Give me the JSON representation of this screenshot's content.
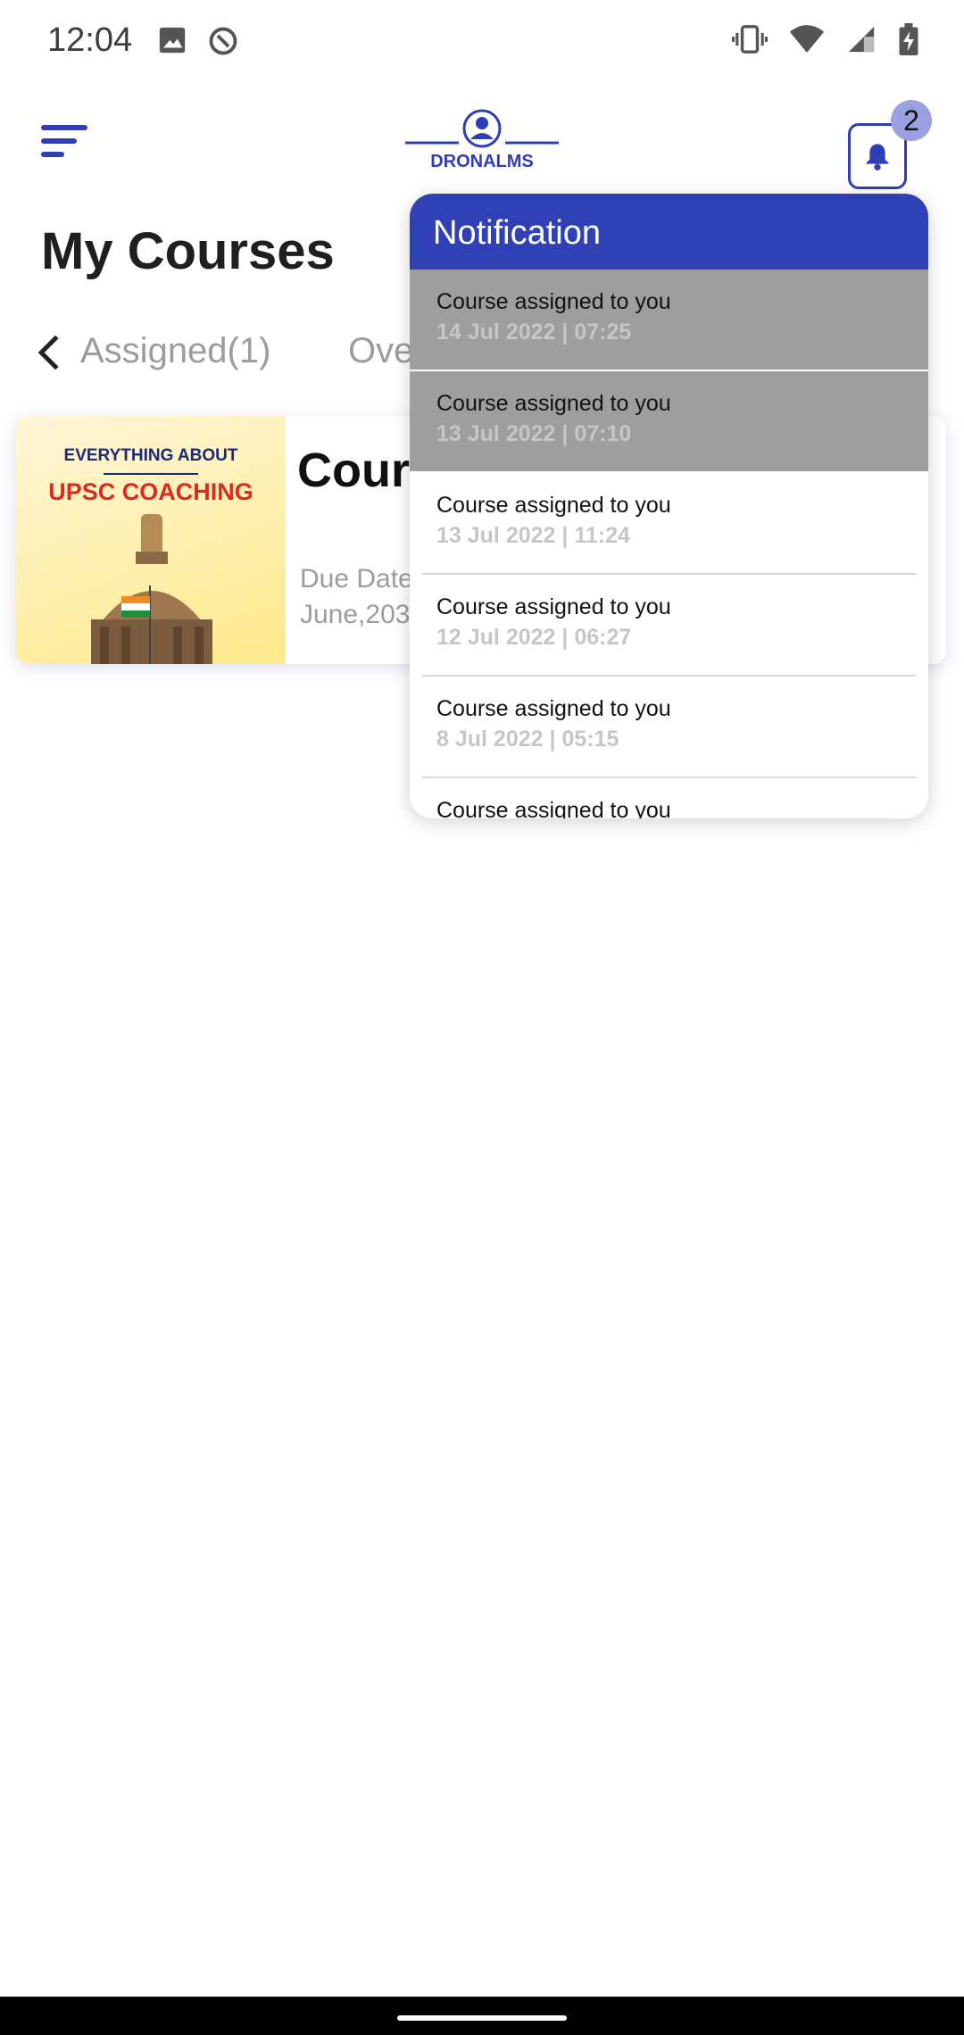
{
  "status_bar": {
    "time": "12:04",
    "icons": [
      "image-icon",
      "data-saver-icon",
      "vibrate-icon",
      "wifi-icon",
      "signal-icon",
      "battery-charging-icon"
    ]
  },
  "header": {
    "logo_text": "DRONALMS",
    "notification_count": "2"
  },
  "page": {
    "title": "My Courses"
  },
  "tabs": [
    {
      "label": "Assigned(1)"
    },
    {
      "label": "Ove"
    }
  ],
  "course": {
    "thumbnail_line1": "EVERYTHING ABOUT",
    "thumbnail_line2": "UPSC COACHING",
    "title": "Cours",
    "due_label": "Due Date",
    "due_value": "June,203"
  },
  "notification_panel": {
    "title": "Notification",
    "items": [
      {
        "title": "Course assigned to you",
        "date": "14 Jul 2022 | 07:25",
        "unread": true
      },
      {
        "title": "Course assigned to you",
        "date": "13 Jul 2022 | 07:10",
        "unread": true
      },
      {
        "title": "Course assigned to you",
        "date": "13 Jul 2022 | 11:24",
        "unread": false
      },
      {
        "title": "Course assigned to you",
        "date": "12 Jul 2022 | 06:27",
        "unread": false
      },
      {
        "title": "Course assigned to you",
        "date": "8 Jul 2022 | 05:15",
        "unread": false
      },
      {
        "title": "Course assigned to you",
        "date": "",
        "unread": false
      }
    ]
  },
  "colors": {
    "brand": "#2f3db6",
    "notif_header": "#3040b5",
    "unread_bg": "#9e9e9e",
    "muted_text": "#9c9c9c"
  }
}
